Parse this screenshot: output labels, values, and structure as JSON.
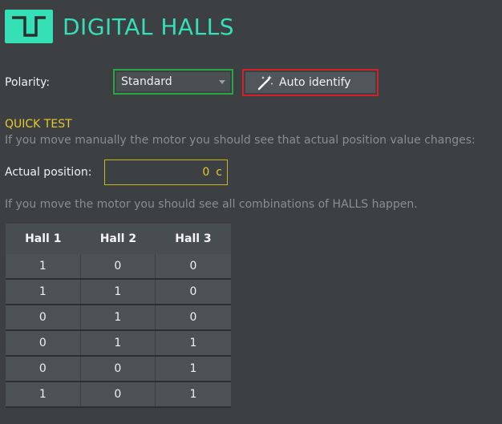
{
  "header": {
    "title": "DIGITAL HALLS",
    "logo_icon": "square-wave-icon",
    "accent": "#35e0b6"
  },
  "polarity": {
    "label": "Polarity:",
    "selected": "Standard",
    "auto_identify_label": "Auto identify",
    "auto_identify_icon": "magic-wand-icon"
  },
  "quick_test": {
    "title": "QUICK TEST",
    "hint_position": "If you move manually the motor you should see that actual position value changes:",
    "actual_position_label": "Actual position:",
    "actual_position_value": "0",
    "actual_position_unit": "c",
    "hint_halls": "If you move the motor you should see all combinations of HALLS happen."
  },
  "halls_table": {
    "headers": [
      "Hall 1",
      "Hall 2",
      "Hall 3"
    ],
    "rows": [
      [
        "1",
        "0",
        "0"
      ],
      [
        "1",
        "1",
        "0"
      ],
      [
        "0",
        "1",
        "0"
      ],
      [
        "0",
        "1",
        "1"
      ],
      [
        "0",
        "0",
        "1"
      ],
      [
        "1",
        "0",
        "1"
      ]
    ]
  }
}
